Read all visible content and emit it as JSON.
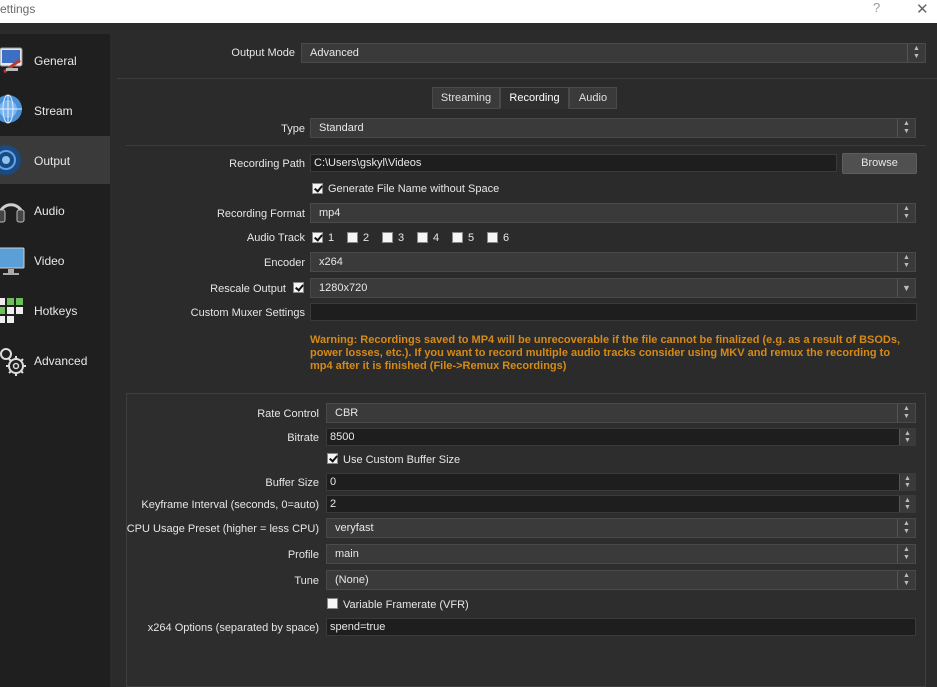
{
  "window": {
    "title": "ettings",
    "help_glyph": "?",
    "close_glyph": "✕"
  },
  "sidebar": {
    "items": [
      {
        "label": "General",
        "icon": "general-icon",
        "active": false
      },
      {
        "label": "Stream",
        "icon": "stream-icon",
        "active": false
      },
      {
        "label": "Output",
        "icon": "output-icon",
        "active": true
      },
      {
        "label": "Audio",
        "icon": "audio-icon",
        "active": false
      },
      {
        "label": "Video",
        "icon": "video-icon",
        "active": false
      },
      {
        "label": "Hotkeys",
        "icon": "hotkeys-icon",
        "active": false
      },
      {
        "label": "Advanced",
        "icon": "advanced-icon",
        "active": false
      }
    ]
  },
  "output_mode": {
    "label": "Output Mode",
    "value": "Advanced"
  },
  "tabs": [
    {
      "label": "Streaming",
      "active": false
    },
    {
      "label": "Recording",
      "active": true
    },
    {
      "label": "Audio",
      "active": false
    }
  ],
  "recording": {
    "type": {
      "label": "Type",
      "value": "Standard"
    },
    "path": {
      "label": "Recording Path",
      "value": "C:\\Users\\gskyl\\Videos",
      "browse": "Browse"
    },
    "no_space": {
      "label": "Generate File Name without Space",
      "checked": true
    },
    "format": {
      "label": "Recording Format",
      "value": "mp4"
    },
    "audio_track": {
      "label": "Audio Track",
      "tracks": [
        {
          "num": "1",
          "checked": true
        },
        {
          "num": "2",
          "checked": false
        },
        {
          "num": "3",
          "checked": false
        },
        {
          "num": "4",
          "checked": false
        },
        {
          "num": "5",
          "checked": false
        },
        {
          "num": "6",
          "checked": false
        }
      ]
    },
    "encoder": {
      "label": "Encoder",
      "value": "x264"
    },
    "rescale": {
      "label": "Rescale Output",
      "checked": true,
      "value": "1280x720"
    },
    "muxer": {
      "label": "Custom Muxer Settings",
      "value": ""
    },
    "warning": "Warning: Recordings saved to MP4 will be unrecoverable if the file cannot be finalized (e.g. as a result of BSODs, power losses, etc.). If you want to record multiple audio tracks consider using MKV and remux the recording to mp4 after it is finished (File->Remux Recordings)"
  },
  "encoder_settings": {
    "rate_control": {
      "label": "Rate Control",
      "value": "CBR"
    },
    "bitrate": {
      "label": "Bitrate",
      "value": "8500"
    },
    "custom_buffer": {
      "label": "Use Custom Buffer Size",
      "checked": true
    },
    "buffer_size": {
      "label": "Buffer Size",
      "value": "0"
    },
    "keyframe": {
      "label": "Keyframe Interval (seconds, 0=auto)",
      "value": "2"
    },
    "cpu_preset": {
      "label": "CPU Usage Preset (higher = less CPU)",
      "value": "veryfast"
    },
    "profile": {
      "label": "Profile",
      "value": "main"
    },
    "tune": {
      "label": "Tune",
      "value": "(None)"
    },
    "vfr": {
      "label": "Variable Framerate (VFR)",
      "checked": false
    },
    "x264_options": {
      "label": "x264 Options (separated by space)",
      "value": "spend=true"
    }
  },
  "colors": {
    "warning": "#d58a18",
    "background": "#2b2b2b",
    "sidebar": "#1f1f1f"
  }
}
